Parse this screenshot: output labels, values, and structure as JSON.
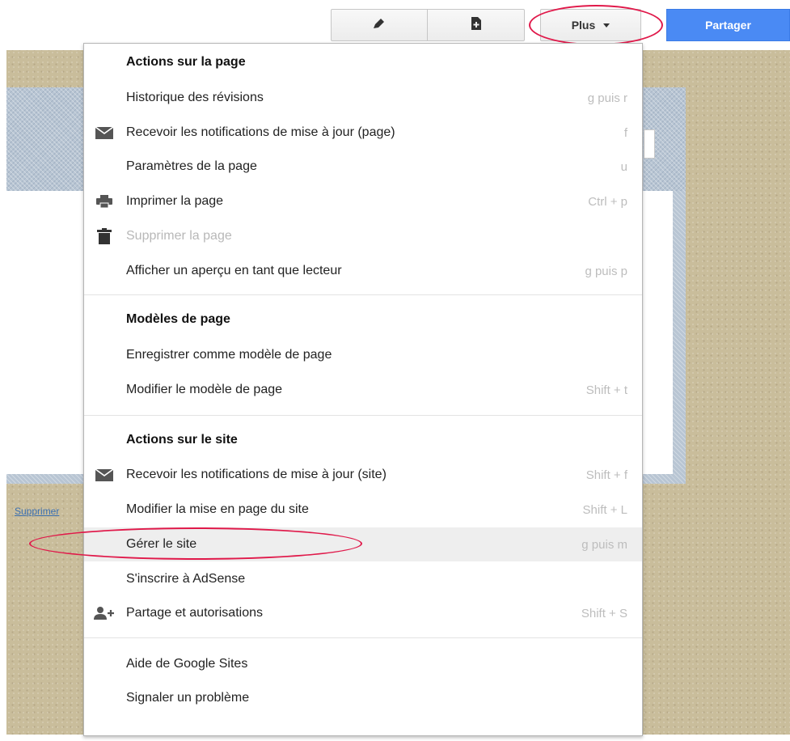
{
  "toolbar": {
    "edit_icon": "pencil-icon",
    "new_page_icon": "new-page-icon",
    "more_label": "Plus",
    "share_label": "Partager"
  },
  "site": {
    "delete_link": "Supprimer"
  },
  "menu": {
    "page_actions": {
      "header": "Actions sur la page",
      "items": [
        {
          "label": "Historique des révisions",
          "shortcut": "g puis r"
        },
        {
          "label": "Recevoir les notifications de mise à jour (page)",
          "shortcut": "f",
          "icon": "envelope-icon"
        },
        {
          "label": "Paramètres de la page",
          "shortcut": "u"
        },
        {
          "label": "Imprimer la page",
          "shortcut": "Ctrl + p",
          "icon": "printer-icon"
        },
        {
          "label": "Supprimer la page",
          "shortcut": "",
          "icon": "trash-icon",
          "disabled": true
        },
        {
          "label": "Afficher un aperçu en tant que lecteur",
          "shortcut": "g puis p"
        }
      ]
    },
    "page_templates": {
      "header": "Modèles de page",
      "items": [
        {
          "label": "Enregistrer comme modèle de page",
          "shortcut": ""
        },
        {
          "label": "Modifier le modèle de page",
          "shortcut": "Shift + t"
        }
      ]
    },
    "site_actions": {
      "header": "Actions sur le site",
      "items": [
        {
          "label": "Recevoir les notifications de mise à jour (site)",
          "shortcut": "Shift + f",
          "icon": "envelope-icon"
        },
        {
          "label": "Modifier la mise en page du site",
          "shortcut": "Shift + L"
        },
        {
          "label": "Gérer le site",
          "shortcut": "g puis m",
          "highlighted": true
        },
        {
          "label": "S'inscrire à AdSense",
          "shortcut": ""
        },
        {
          "label": "Partage et autorisations",
          "shortcut": "Shift + S",
          "icon": "add-person-icon"
        }
      ]
    },
    "help": {
      "items": [
        {
          "label": "Aide de Google Sites",
          "shortcut": ""
        },
        {
          "label": "Signaler un problème",
          "shortcut": ""
        }
      ]
    }
  },
  "colors": {
    "share_button": "#4a8af4",
    "annotation": "#e0194a",
    "highlight": "#eeeeee"
  }
}
